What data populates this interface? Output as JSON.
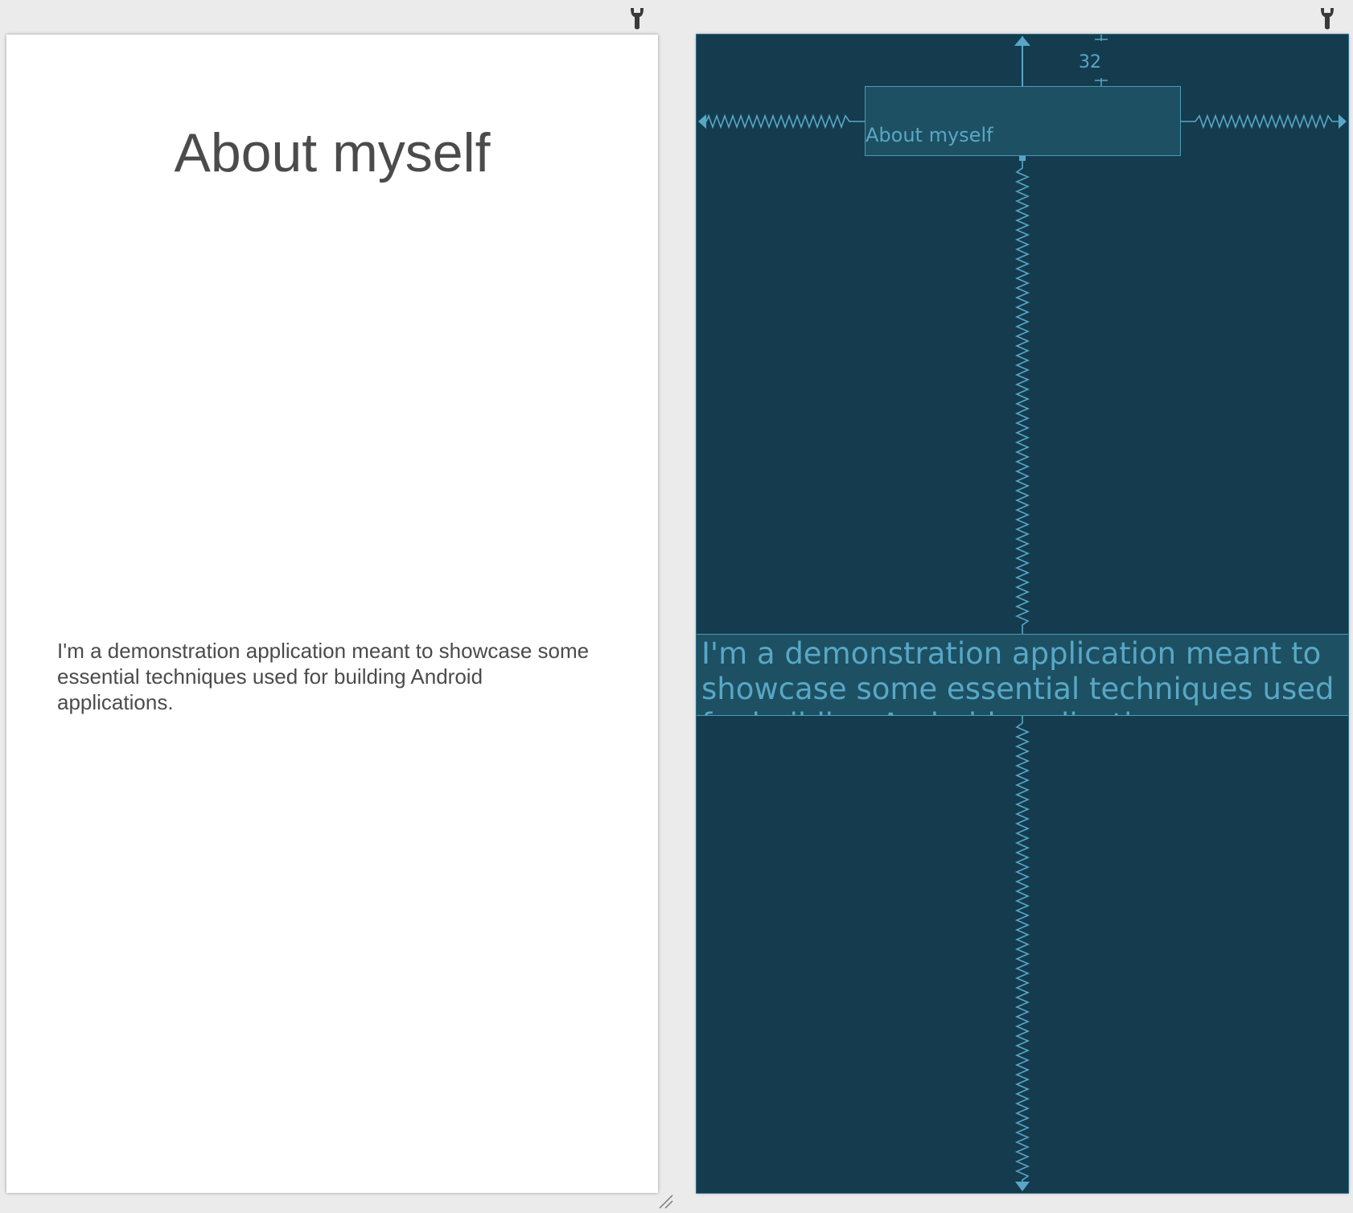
{
  "design_view": {
    "title": "About myself",
    "body": "I'm a demonstration application meant to showcase some essential techniques used for building Android applications."
  },
  "blueprint_view": {
    "title": "About myself",
    "body": "I'm a demonstration application meant to showcase some essential techniques used for building Android applications.",
    "top_margin_label": "32"
  },
  "toolbar": {
    "icon": "wrench-icon"
  },
  "colors": {
    "canvas": "#ebebeb",
    "design_background": "#ffffff",
    "design_text": "#4b4b4b",
    "blueprint_background": "#143c4e",
    "blueprint_widget": "#1d5062",
    "blueprint_line": "#58a7c6"
  }
}
